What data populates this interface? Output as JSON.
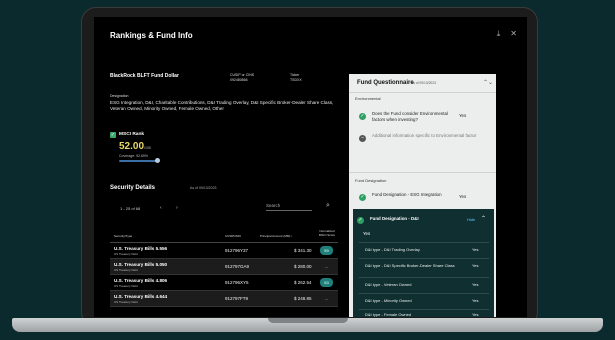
{
  "app": {
    "title": "Rankings & Fund Info",
    "icons": [
      "download-icon",
      "close-icon"
    ]
  },
  "fund": {
    "name": "BlackRock BLFT Fund Dollar",
    "cusip_label": "CUSIP or CINS",
    "cusip_value": "092480866",
    "ticker_label": "Ticker",
    "ticker_value": "TSDXX",
    "designation_label": "Designation",
    "designation_text": "ESG Integration, D&I, Charitable Contributions, D&I Trading Overlay, D&I Specific Broker-Dealer Share Class, Veteran Owned, Minority Owned, Female Owned, Other"
  },
  "msci": {
    "title": "MSCI Rank",
    "score": "52.00",
    "score_max": "/100",
    "coverage": "Coverage: 92.69%",
    "coverage_fraction": 0.9269
  },
  "security": {
    "title": "Security Details",
    "as_of": "As of 09/13/2023",
    "pager_text": "1 - 25 of 68",
    "prev": "‹",
    "next": "›",
    "search_placeholder": "Search",
    "columns": [
      "Security/Type",
      "CUSIP/ISIN",
      "Principal Amount (MM) ↓",
      "Normalized MSCI Score"
    ],
    "rows": [
      {
        "name": "U.S. Treasury Bills 5.556",
        "type": "US Treasury Debt",
        "cusip": "912796Y37",
        "amount": "$ 341.30",
        "score": "59"
      },
      {
        "name": "U.S. Treasury Bills 5.050",
        "type": "US Treasury Debt",
        "cusip": "912797GA9",
        "amount": "$ 280.00",
        "score": "--"
      },
      {
        "name": "U.S. Treasury Bills 4.806",
        "type": "US Treasury Debt",
        "cusip": "912796XY5",
        "amount": "$ 262.54",
        "score": "63"
      },
      {
        "name": "U.S. Treasury Bills 4.644",
        "type": "US Treasury Debt",
        "cusip": "912797FT9",
        "amount": "$ 248.85",
        "score": "--"
      }
    ]
  },
  "questionnaire": {
    "title": "Fund Questionnaire",
    "as_of": "As of 09/13/2023",
    "toggle": "⌃⌄",
    "environmental_label": "Environmental",
    "q1": "Does the Fund consider Environmental factors when investing?",
    "q1_val": "Yes",
    "q2": "Additional information specific to Environmental factor",
    "fund_designation_label": "Fund Designation",
    "q3": "Fund Designation - ESG Integration",
    "q3_val": "Yes",
    "q4": "Fund Designation - D&I",
    "q4_hide": "Hide",
    "q4_val": "Yes",
    "subitems": [
      {
        "label": "D&I type - D&I Trading Overlay",
        "value": "Yes"
      },
      {
        "label": "D&I type - D&I Specific Broker-Dealer Share Class",
        "value": "Yes"
      },
      {
        "label": "D&I type - Veteran Owned",
        "value": "Yes"
      },
      {
        "label": "D&I type - Minority Owned",
        "value": "Yes"
      },
      {
        "label": "D&I type - Female Owned",
        "value": "Yes"
      }
    ]
  },
  "colors": {
    "background": "#0b2a2e",
    "accent_green": "#2e9e63",
    "score_badge": "#1f7f7a",
    "msci_score": "#e8d86a",
    "panel_dark": "#0f2f31"
  }
}
